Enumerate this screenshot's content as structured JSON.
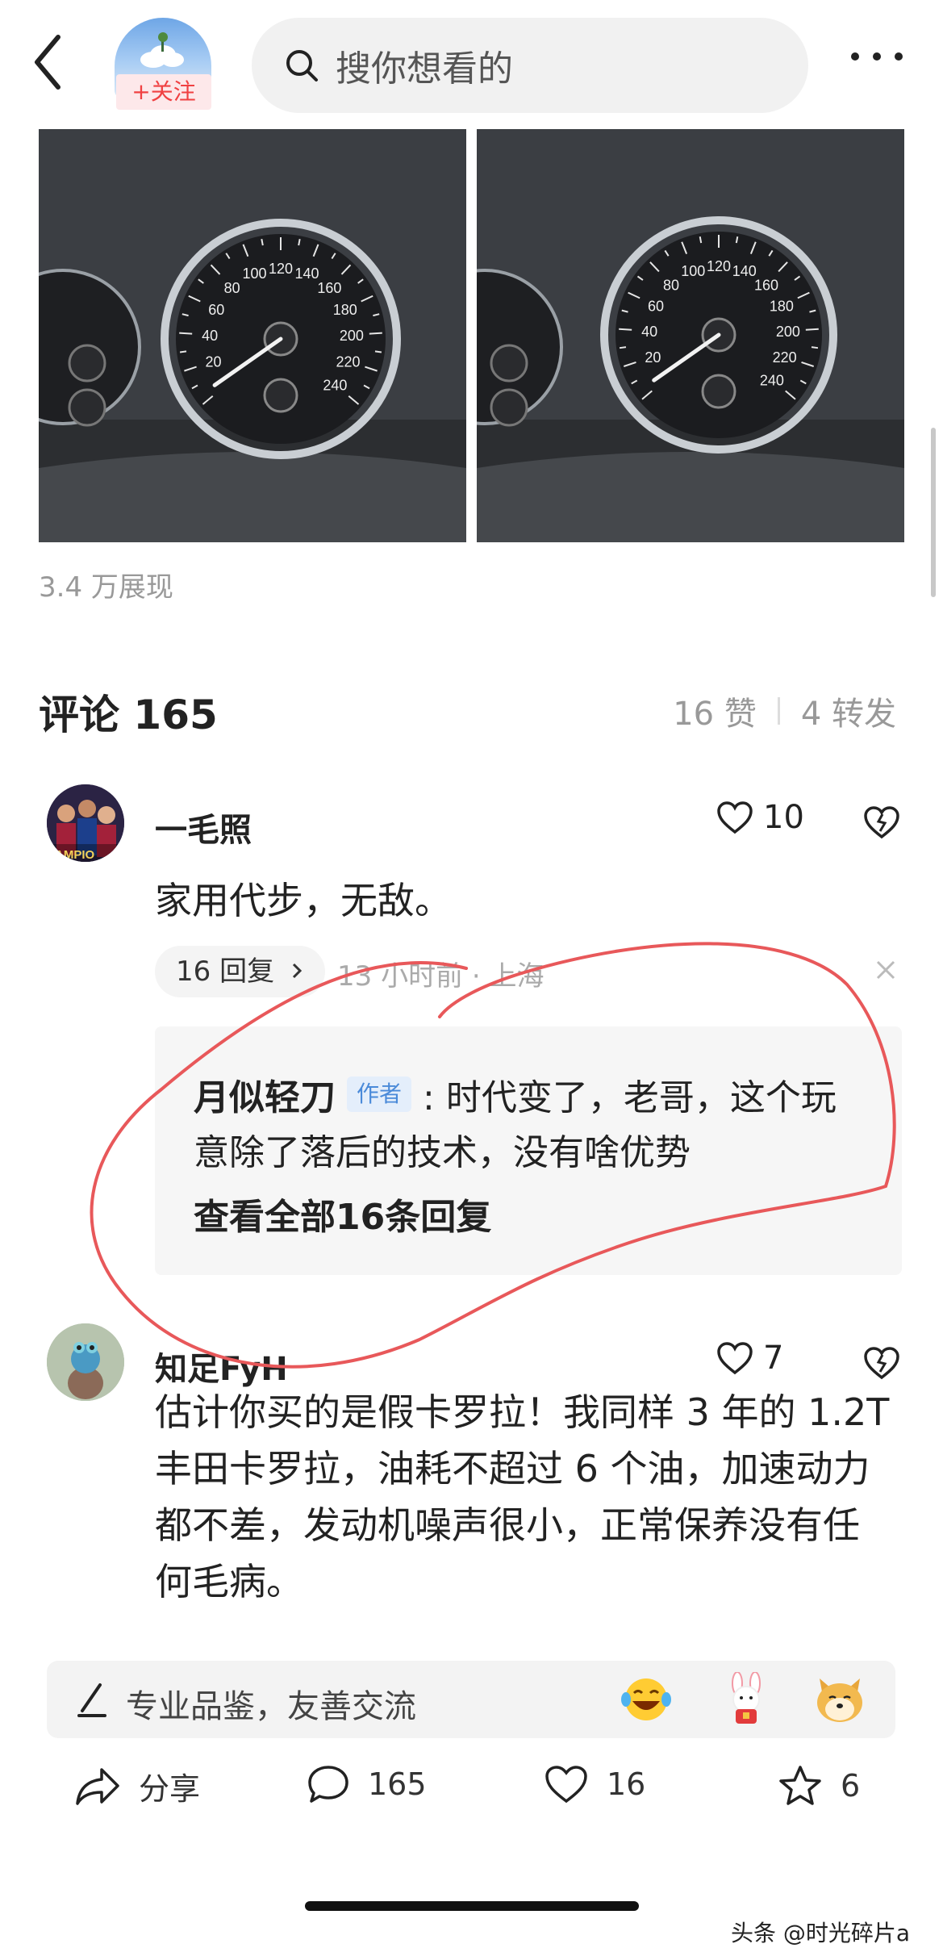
{
  "header": {
    "follow_label": "+关注",
    "search_placeholder": "搜你想看的"
  },
  "post": {
    "views": "3.4 万展现"
  },
  "comments_section": {
    "title": "评论 165",
    "likes": "16 赞",
    "reposts": "4 转发"
  },
  "comment1": {
    "name": "一毛照",
    "like_count": "10",
    "text": "家用代步，无敌。",
    "reply_button": "16 回复",
    "meta": "13 小时前 · 上海",
    "reply": {
      "author": "月似轻刀",
      "author_tag": "作者",
      "line1": ": 时代变了，老哥，这个玩",
      "line2": "意除了落后的技术，没有啥优势",
      "view_all": "查看全部16条回复"
    }
  },
  "comment2": {
    "name": "知足FyH",
    "like_count": "7",
    "lines": [
      "估计你买的是假卡罗拉！我同样 3 年的 1.2T",
      "丰田卡罗拉，油耗不超过 6 个油，加速动力",
      "都不差，发动机噪声很小，正常保养没有任",
      "何毛病。"
    ]
  },
  "input_bar": {
    "placeholder": "专业品鉴，友善交流"
  },
  "toolbar": {
    "share_label": "分享",
    "comment_count": "165",
    "like_count": "16",
    "fav_count": "6"
  },
  "speedometer": {
    "labels": [
      "20",
      "40",
      "60",
      "80",
      "100",
      "120",
      "140",
      "160",
      "180",
      "200",
      "220",
      "240"
    ]
  },
  "watermark": "头条 @时光碎片a",
  "colors": {
    "accent": "#f04142",
    "annotation": "#e8585a",
    "tag_blue": "#4a8ad9"
  }
}
